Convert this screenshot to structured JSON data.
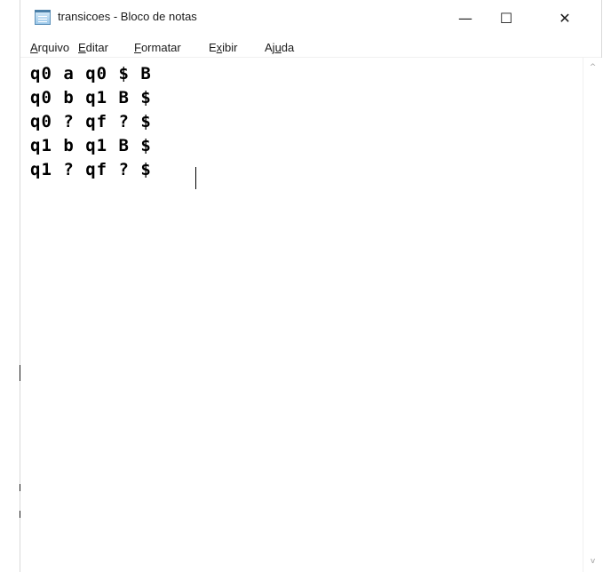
{
  "window": {
    "title": "transicoes - Bloco de notas",
    "minimize_glyph": "—",
    "maximize_glyph": "☐",
    "close_glyph": "✕",
    "icon": "notepad-icon"
  },
  "menu": {
    "items": [
      {
        "label": "Arquivo",
        "underline": "A"
      },
      {
        "label": "Editar",
        "underline": "E"
      },
      {
        "label": "Formatar",
        "underline": "F"
      },
      {
        "label": "Exibir",
        "underline": "x"
      },
      {
        "label": "Ajuda",
        "underline": "u"
      }
    ]
  },
  "editor": {
    "lines": [
      "q0 a q0 $ B",
      "q0 b q1 B $",
      "q0 ? qf ? $",
      "q1 b q1 B $",
      "q1 ? qf ? $"
    ]
  },
  "scrollbar": {
    "up_glyph": "^",
    "down_glyph": "v"
  }
}
